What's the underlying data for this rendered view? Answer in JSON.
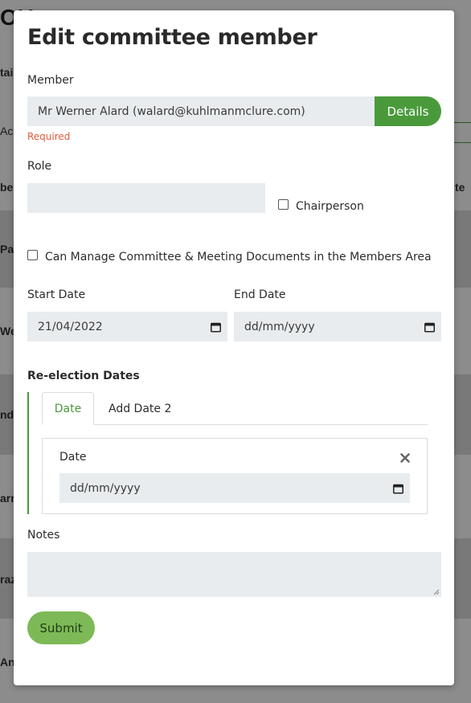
{
  "background": {
    "title_fragment": "OU",
    "side_labels": [
      "tai",
      "Ac",
      "be",
      "Pat",
      "Wer",
      "nd",
      "arri",
      "raz",
      "Ang"
    ],
    "right_label": "te"
  },
  "modal": {
    "title": "Edit committee member",
    "member": {
      "label": "Member",
      "value": "Mr Werner Alard (walard@kuhlmanmclure.com)",
      "details_button": "Details",
      "required_text": "Required"
    },
    "role": {
      "label": "Role",
      "value": "",
      "chairperson_label": "Chairperson",
      "chairperson_checked": false
    },
    "manage_docs": {
      "label": "Can Manage Committee & Meeting Documents in the Members Area",
      "checked": false
    },
    "start_date": {
      "label": "Start Date",
      "value": "21/04/2022"
    },
    "end_date": {
      "label": "End Date",
      "placeholder": "dd/mm/yyyy"
    },
    "reelection": {
      "heading": "Re-election Dates",
      "tabs": [
        {
          "label": "Date",
          "active": true
        },
        {
          "label": "Add Date 2",
          "active": false
        }
      ],
      "date_label": "Date",
      "date_placeholder": "dd/mm/yyyy"
    },
    "notes": {
      "label": "Notes",
      "value": ""
    },
    "submit_button": "Submit"
  },
  "colors": {
    "accent_green": "#4a9a3c",
    "submit_green": "#7dba57",
    "required_red": "#e05a3a",
    "field_bg": "#e9ecee"
  },
  "icons": [
    "calendar-icon",
    "close-icon"
  ]
}
